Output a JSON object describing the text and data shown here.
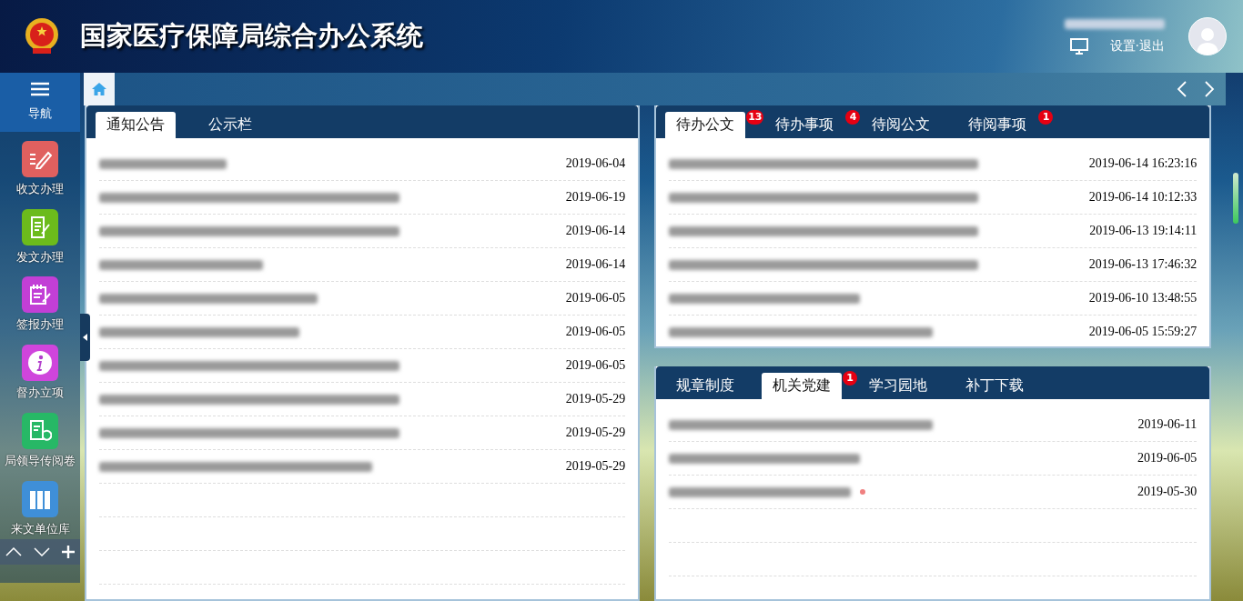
{
  "header": {
    "title": "国家医疗保障局综合办公系统",
    "user_actions": "设置·退出"
  },
  "sidebar": {
    "nav_label": "导航",
    "items": [
      {
        "label": "收文办理",
        "color": "#e0605f"
      },
      {
        "label": "发文办理",
        "color": "#6cbb1c"
      },
      {
        "label": "签报办理",
        "color": "#c23fd6"
      },
      {
        "label": "督办立项",
        "color": "#cf45dc"
      },
      {
        "label": "局领导传阅卷",
        "color": "#27b866"
      },
      {
        "label": "来文单位库",
        "color": "#3f8fd8"
      }
    ]
  },
  "panels": [
    {
      "tabs": [
        {
          "label": "通知公告",
          "selected": true
        },
        {
          "label": "公示栏",
          "selected": false
        }
      ],
      "rows": [
        {
          "date": "2019-06-04"
        },
        {
          "date": "2019-06-19"
        },
        {
          "date": "2019-06-14"
        },
        {
          "date": "2019-06-14"
        },
        {
          "date": "2019-06-05"
        },
        {
          "date": "2019-06-05"
        },
        {
          "date": "2019-06-05"
        },
        {
          "date": "2019-05-29"
        },
        {
          "date": "2019-05-29"
        },
        {
          "date": "2019-05-29"
        }
      ]
    },
    {
      "tabs": [
        {
          "label": "待办公文",
          "selected": true,
          "badge": "13"
        },
        {
          "label": "待办事项",
          "selected": false,
          "badge": "4"
        },
        {
          "label": "待阅公文",
          "selected": false
        },
        {
          "label": "待阅事项",
          "selected": false,
          "badge": "1"
        }
      ],
      "rows": [
        {
          "date": "2019-06-14 16:23:16"
        },
        {
          "date": "2019-06-14 10:12:33"
        },
        {
          "date": "2019-06-13 19:14:11"
        },
        {
          "date": "2019-06-13 17:46:32"
        },
        {
          "date": "2019-06-10 13:48:55"
        },
        {
          "date": "2019-06-05 15:59:27"
        }
      ]
    },
    {
      "tabs": [
        {
          "label": "规章制度",
          "selected": false
        },
        {
          "label": "机关党建",
          "selected": true,
          "badge": "1"
        },
        {
          "label": "学习园地",
          "selected": false
        },
        {
          "label": "补丁下载",
          "selected": false
        }
      ],
      "rows": [
        {
          "date": "2019-06-11",
          "new": false
        },
        {
          "date": "2019-06-05",
          "new": false
        },
        {
          "date": "2019-05-30",
          "new": true
        }
      ]
    }
  ]
}
